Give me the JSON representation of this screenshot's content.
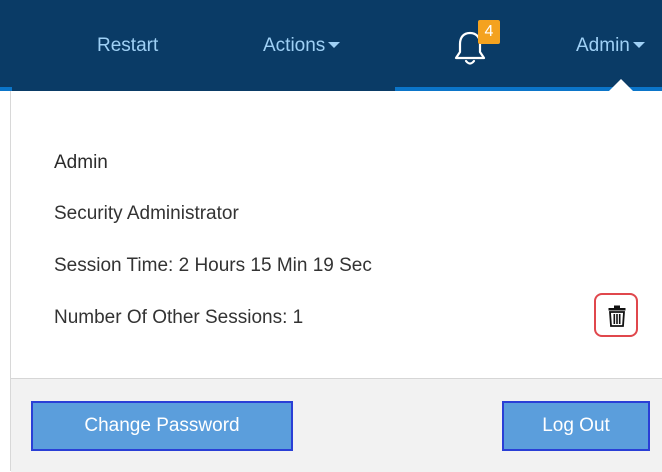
{
  "navbar": {
    "restart_label": "Restart",
    "actions_label": "Actions",
    "notifications_count": "4",
    "admin_label": "Admin"
  },
  "user_panel": {
    "name": "Admin",
    "role": "Security Administrator",
    "session_time": "Session Time: 2 Hours 15 Min 19 Sec",
    "other_sessions": "Number Of Other Sessions: 1"
  },
  "footer": {
    "change_password_label": "Change Password",
    "logout_label": "Log Out"
  },
  "icons": {
    "notifications": "bell-icon",
    "delete_sessions": "trash-icon",
    "dropdown": "caret-down-icon"
  },
  "colors": {
    "navbar_bg": "#0a3b66",
    "nav_text": "#9fd0f5",
    "badge": "#f4a21f",
    "button_bg": "#5b9edc",
    "button_border": "#2a3fd6",
    "delete_border": "#e0474c"
  }
}
